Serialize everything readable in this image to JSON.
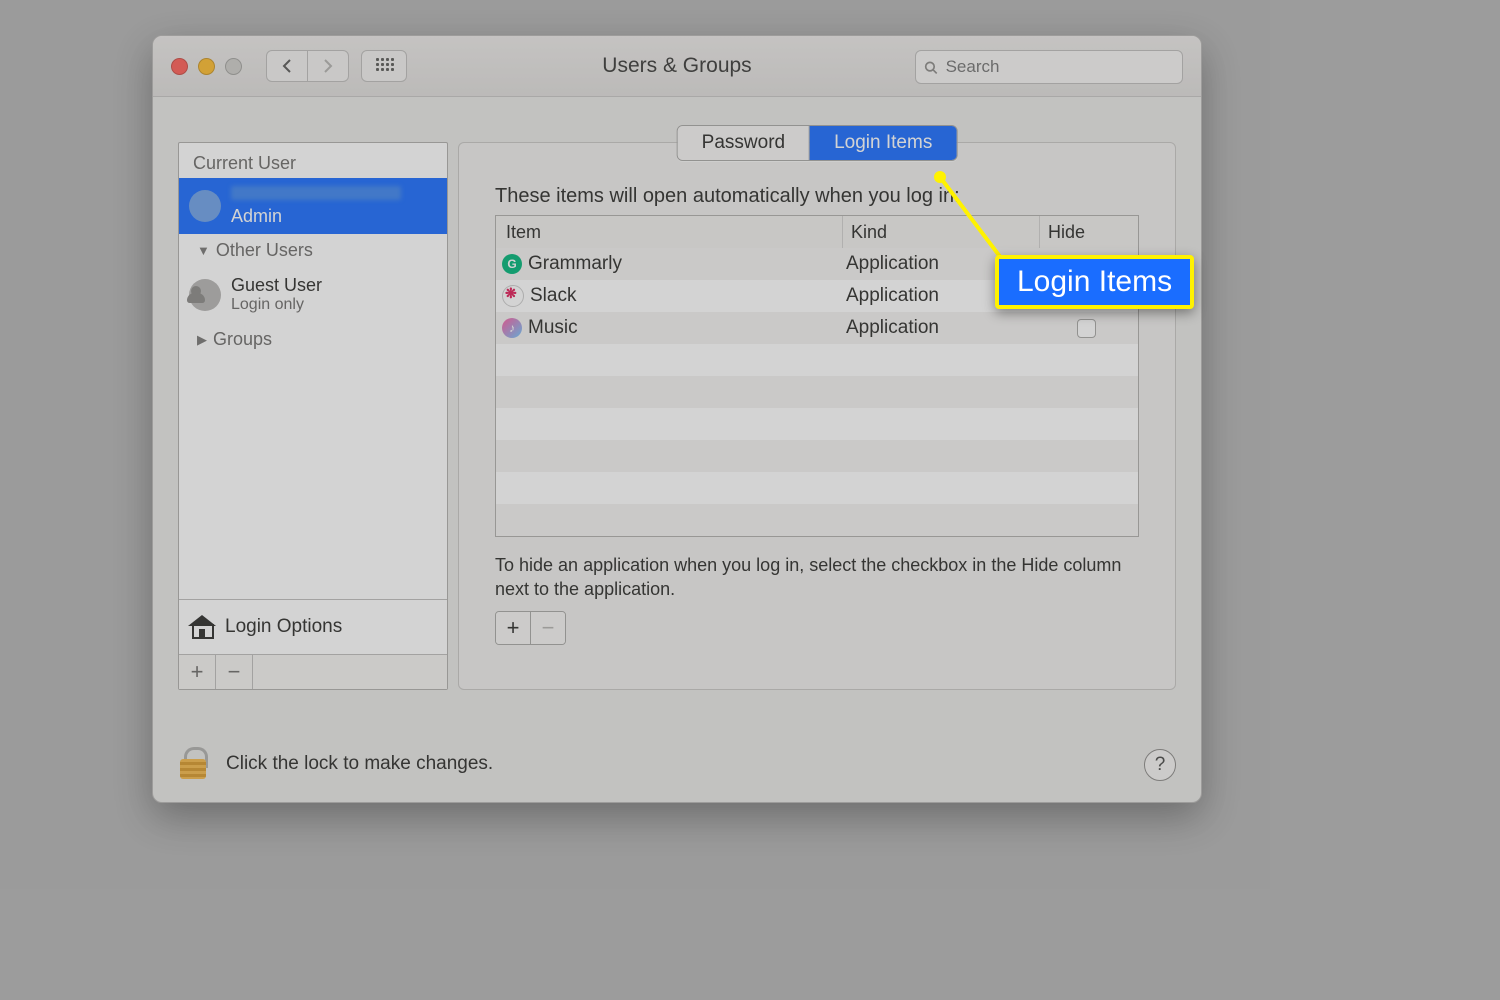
{
  "window": {
    "title": "Users & Groups",
    "search_placeholder": "Search"
  },
  "sidebar": {
    "current_user_label": "Current User",
    "current_user": {
      "role": "Admin"
    },
    "other_users_label": "Other Users",
    "guest": {
      "name": "Guest User",
      "sub": "Login only"
    },
    "groups_label": "Groups",
    "login_options": "Login Options"
  },
  "tabs": {
    "password": "Password",
    "login_items": "Login Items"
  },
  "main": {
    "caption": "These items will open automatically when you log in:",
    "columns": {
      "item": "Item",
      "kind": "Kind",
      "hide": "Hide"
    },
    "rows": [
      {
        "name": "Grammarly",
        "kind": "Application",
        "icon": "g",
        "hide": false
      },
      {
        "name": "Slack",
        "kind": "Application",
        "icon": "s",
        "hide": false
      },
      {
        "name": "Music",
        "kind": "Application",
        "icon": "m",
        "hide": false
      }
    ],
    "hint": "To hide an application when you log in, select the checkbox in the Hide column next to the application."
  },
  "lock_text": "Click the lock to make changes.",
  "callout": "Login Items"
}
